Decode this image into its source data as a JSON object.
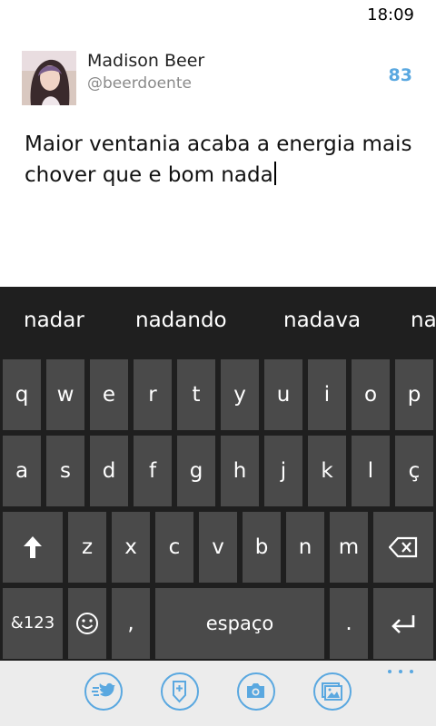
{
  "status": {
    "time": "18:09"
  },
  "author": {
    "name": "Madison Beer",
    "handle": "@beerdoente",
    "chars_remaining": "83"
  },
  "compose": {
    "line1": "Maior ventania acaba a energia mais",
    "line2": "chover que e bom nada"
  },
  "suggestions": [
    "nadar",
    "nadando",
    "nadava",
    "na"
  ],
  "keyboard": {
    "row1": [
      "q",
      "w",
      "e",
      "r",
      "t",
      "y",
      "u",
      "i",
      "o",
      "p"
    ],
    "row2": [
      "a",
      "s",
      "d",
      "f",
      "g",
      "h",
      "j",
      "k",
      "l",
      "ç"
    ],
    "row3": [
      "z",
      "x",
      "c",
      "v",
      "b",
      "n",
      "m"
    ],
    "numbers_label": "&123",
    "comma": ",",
    "space_label": "espaço",
    "period": "."
  },
  "app_bar": {
    "buttons": [
      "mention-icon",
      "location-pin-icon",
      "camera-icon",
      "photo-gallery-icon"
    ],
    "accent_color": "#5aa8e0",
    "more": "more-icon"
  }
}
